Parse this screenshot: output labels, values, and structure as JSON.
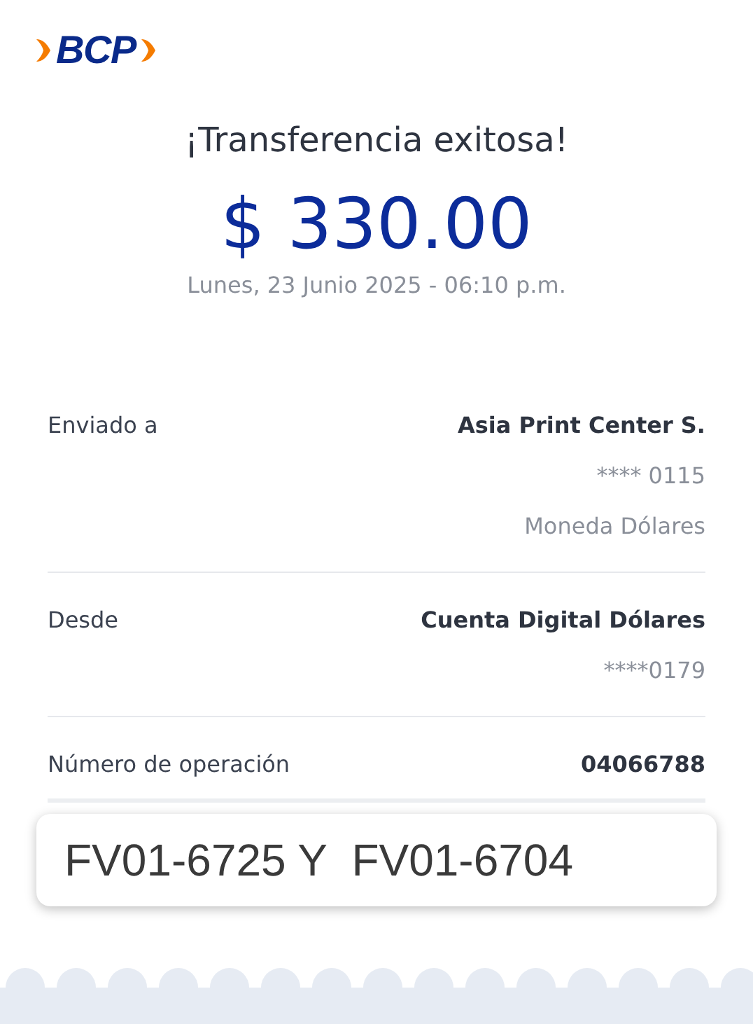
{
  "logo": {
    "text": "BCP"
  },
  "title": "¡Transferencia exitosa!",
  "amount": "$ 330.00",
  "date": "Lunes, 23 Junio 2025 - 06:10 p.m.",
  "details": [
    {
      "label": "Enviado a",
      "lines": [
        "Asia Print Center S.",
        "**** 0115",
        "Moneda Dólares"
      ]
    },
    {
      "label": "Desde",
      "lines": [
        "Cuenta Digital Dólares",
        "****0179"
      ]
    },
    {
      "label": "Número de operación",
      "lines": [
        "04066788"
      ]
    }
  ],
  "note": "FV01-6725 Y  FV01-6704"
}
